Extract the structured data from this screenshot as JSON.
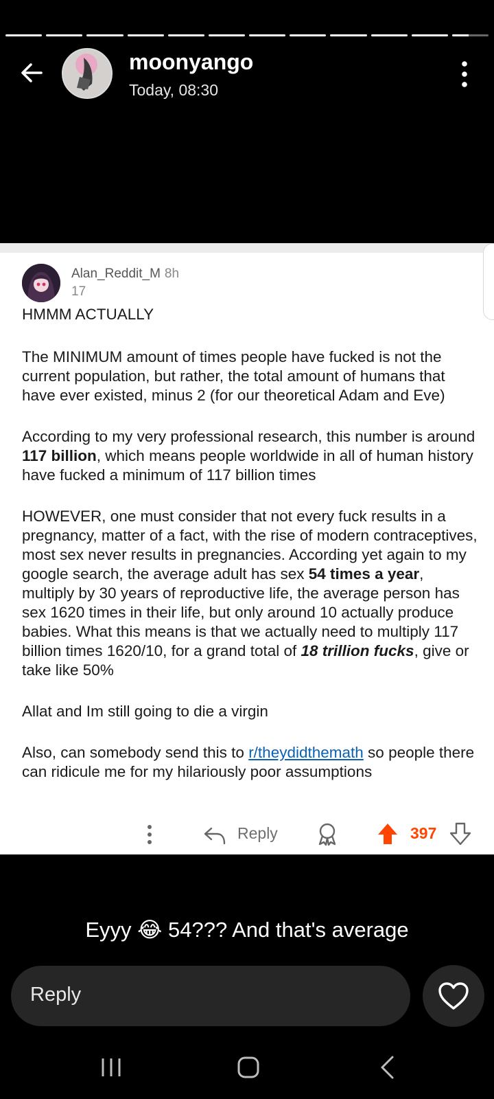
{
  "story": {
    "segments_total": 12,
    "segments_complete": 11,
    "current_segment_progress": 0.45,
    "username": "moonyango",
    "timestamp": "Today, 08:30",
    "icons": {
      "back": "back-arrow-icon",
      "more": "more-vertical-icon"
    }
  },
  "post": {
    "author": "Alan_Reddit_M",
    "age": "8h",
    "karma": "17",
    "paragraphs": [
      [
        {
          "t": "HMMM ACTUALLY"
        }
      ],
      [
        {
          "t": "The MINIMUM amount of times people have fucked is not the current population, but rather, the total amount of humans that have ever existed, minus 2 (for our theoretical Adam and Eve)"
        }
      ],
      [
        {
          "t": "According to my very professional research, this number is around "
        },
        {
          "t": "117 billion",
          "b": true
        },
        {
          "t": ", which means people worldwide in all of human history have fucked a minimum of 117 billion times"
        }
      ],
      [
        {
          "t": "HOWEVER, one must consider that not every fuck results in a pregnancy, matter of a fact, with the rise of modern contraceptives, most sex never results in pregnancies. According yet again to my google search, the average adult has sex "
        },
        {
          "t": "54 times a year",
          "b": true
        },
        {
          "t": ", multiply by 30 years of reproductive life, the average person has sex 1620 times in their life, but only around 10 actually produce babies. What this means is that we actually need to multiply 117 billion times 1620/10, for a grand total of "
        },
        {
          "t": "18 trillion fucks",
          "b": true,
          "i": true
        },
        {
          "t": ", give or take like 50%"
        }
      ],
      [
        {
          "t": "Allat and Im still going to die a virgin"
        }
      ],
      [
        {
          "t": "Also, can somebody send this to "
        },
        {
          "t": "r/theydidthemath",
          "link": true
        },
        {
          "t": " so people there can ridicule me for my hilariously poor assumptions"
        }
      ]
    ],
    "actions": {
      "reply_label": "Reply",
      "score": "397",
      "icons": {
        "more": "more-vertical-icon",
        "reply": "reply-arrow-icon",
        "award": "award-icon",
        "upvote": "upvote-icon",
        "downvote": "downvote-icon"
      },
      "upvote_color": "#ff4500"
    }
  },
  "caption": "Eyyy 😂 54??? And that's average",
  "reply_box": {
    "placeholder": "Reply"
  },
  "like_button": {
    "icon": "heart-icon"
  },
  "navbar": {
    "icons": [
      "recent-apps-icon",
      "home-icon",
      "back-icon"
    ]
  }
}
